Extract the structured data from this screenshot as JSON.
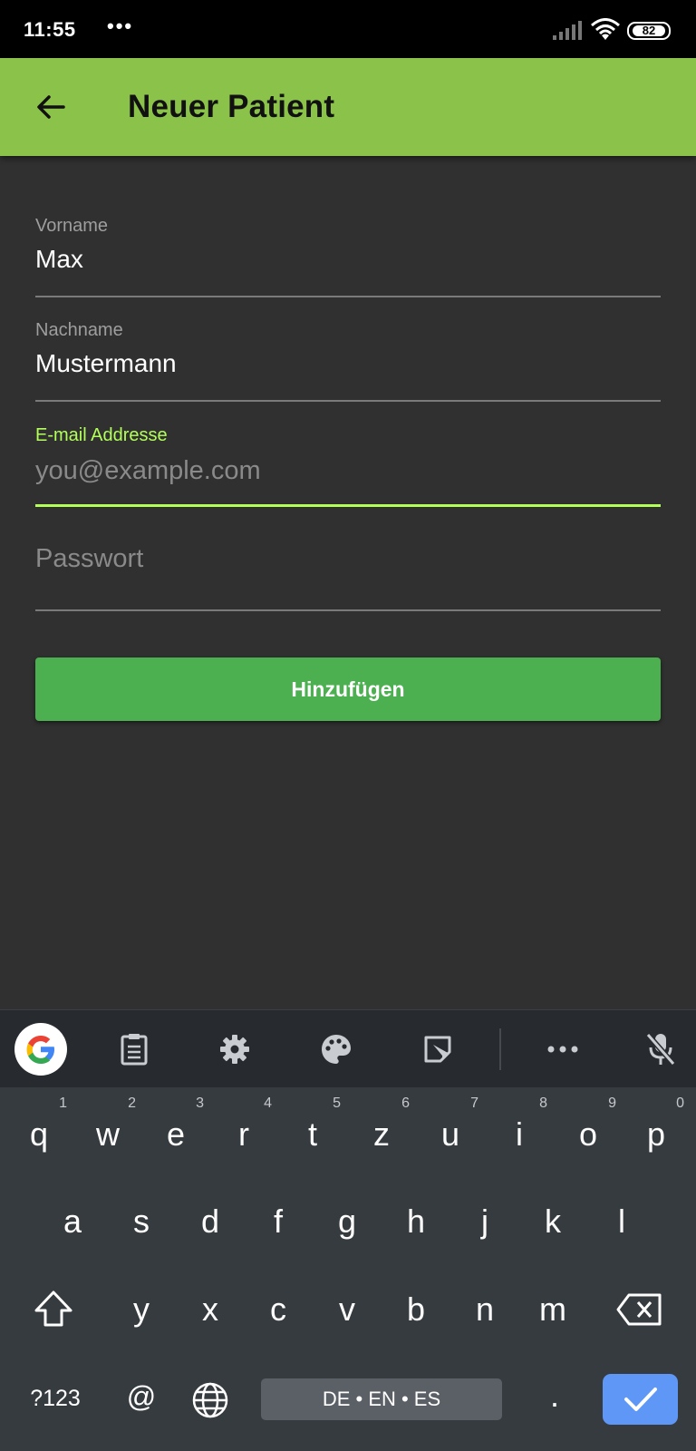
{
  "status_bar": {
    "time": "11:55",
    "dots": "•••",
    "battery": "82"
  },
  "app_bar": {
    "title": "Neuer Patient",
    "back_icon": "arrow-back-icon"
  },
  "form": {
    "first_name": {
      "label": "Vorname",
      "value": "Max"
    },
    "last_name": {
      "label": "Nachname",
      "value": "Mustermann"
    },
    "email": {
      "label": "E-mail Addresse",
      "placeholder": "you@example.com",
      "value": ""
    },
    "password": {
      "placeholder": "Passwort",
      "value": ""
    },
    "submit_label": "Hinzufügen"
  },
  "colors": {
    "accent": "#8bc34a",
    "focus": "#b2ff59",
    "button": "#4caf50",
    "background": "#303030"
  },
  "keyboard": {
    "toolbar_icons": [
      "google-icon",
      "clipboard-icon",
      "settings-icon",
      "palette-icon",
      "sticker-icon",
      "more-icon",
      "mic-off-icon"
    ],
    "row1": [
      "q",
      "w",
      "e",
      "r",
      "t",
      "z",
      "u",
      "i",
      "o",
      "p"
    ],
    "row1_hints": [
      "1",
      "2",
      "3",
      "4",
      "5",
      "6",
      "7",
      "8",
      "9",
      "0"
    ],
    "row2": [
      "a",
      "s",
      "d",
      "f",
      "g",
      "h",
      "j",
      "k",
      "l"
    ],
    "row3": [
      "y",
      "x",
      "c",
      "v",
      "b",
      "n",
      "m"
    ],
    "symbols_key": "?123",
    "at_key": "@",
    "space_label": "DE • EN • ES",
    "period_key": "."
  }
}
